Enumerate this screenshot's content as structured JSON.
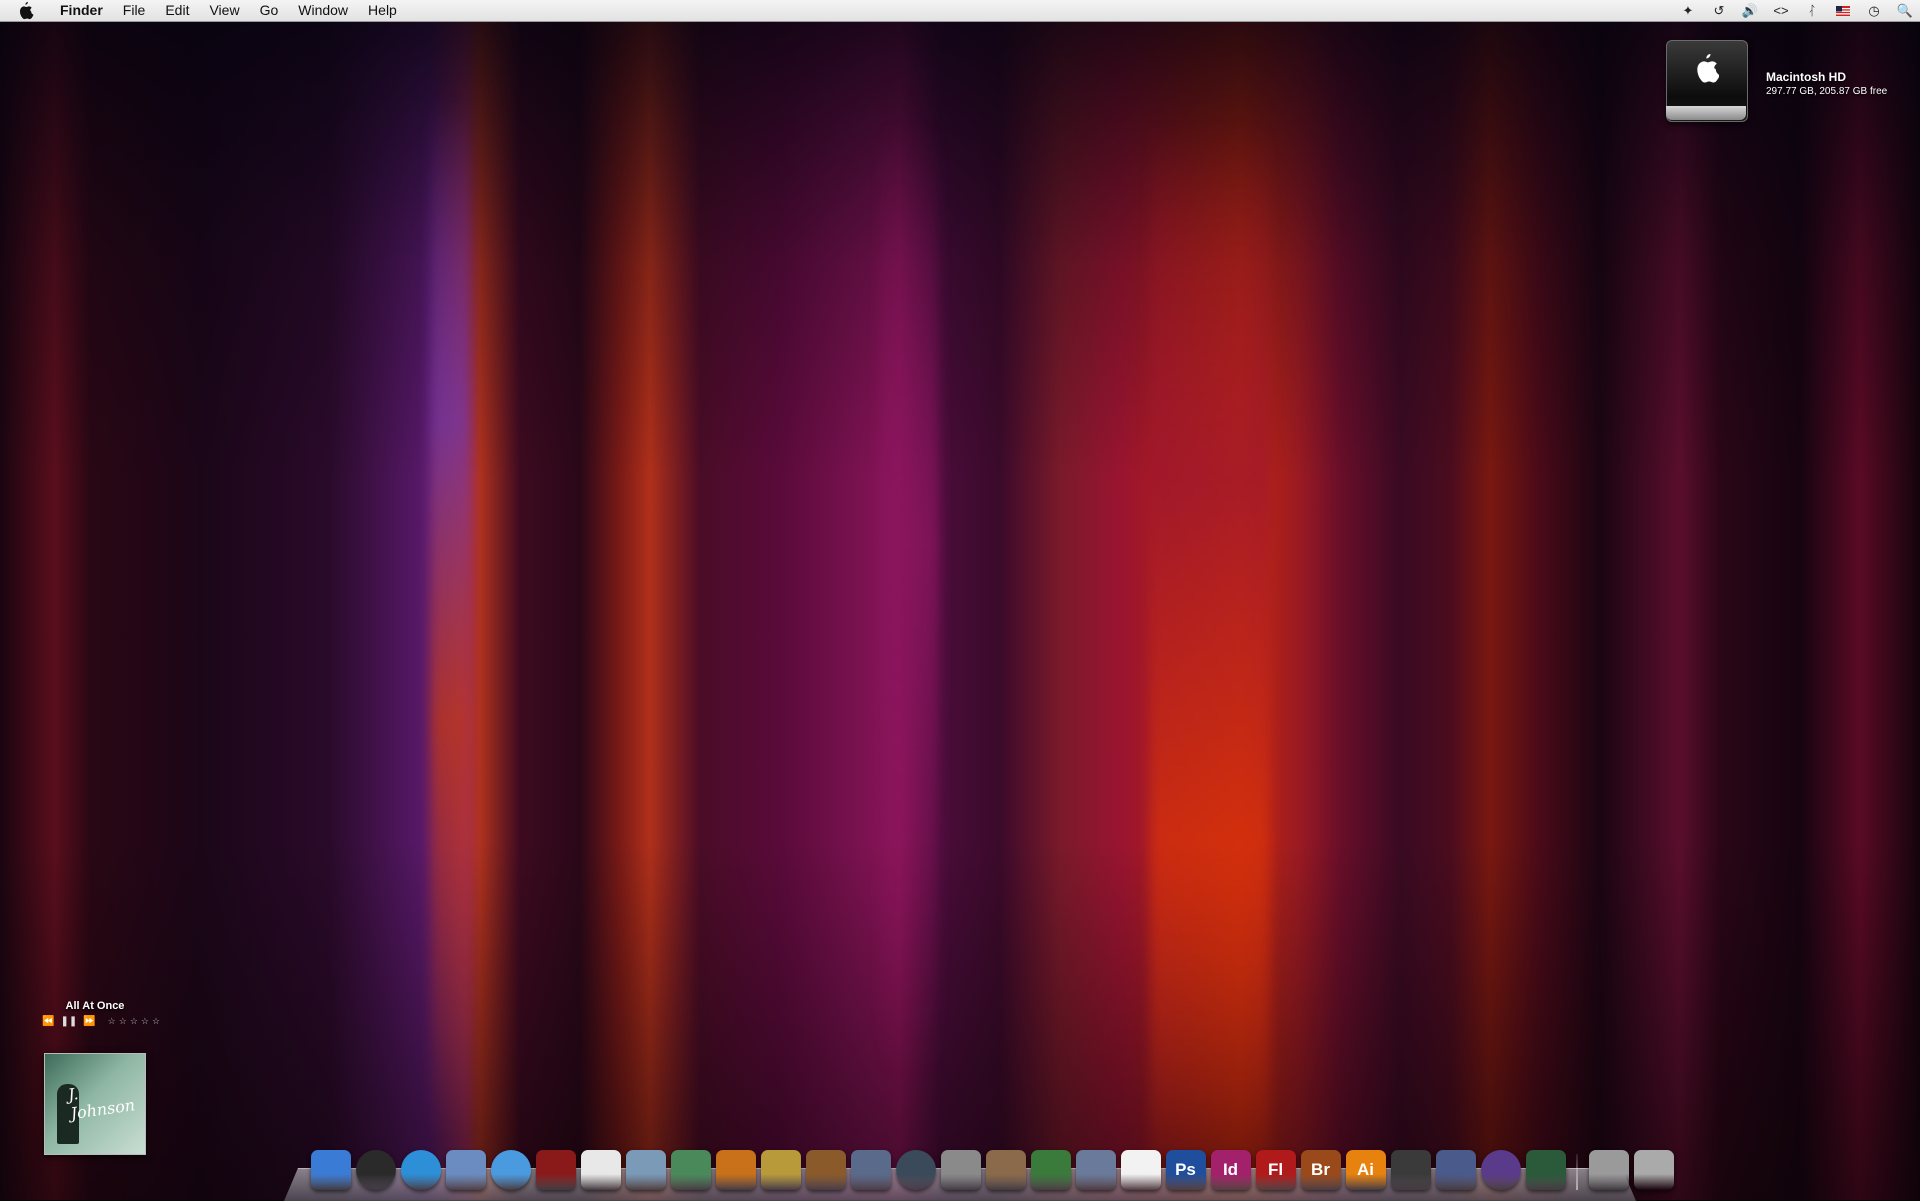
{
  "menubar": {
    "app_name": "Finder",
    "items": [
      "File",
      "Edit",
      "View",
      "Go",
      "Window",
      "Help"
    ],
    "status_icons": [
      "growl-icon",
      "time-machine-icon",
      "volume-icon",
      "script-icon",
      "bluetooth-icon",
      "flag-icon",
      "clock-icon",
      "spotlight-icon"
    ]
  },
  "drive": {
    "name": "Macintosh HD",
    "info": "297.77 GB, 205.87 GB free"
  },
  "itunes": {
    "track_title": "All At Once",
    "rating_stars": 5
  },
  "dock": {
    "apps": [
      {
        "name": "finder-icon",
        "color": "#3a7bd5"
      },
      {
        "name": "dashboard-icon",
        "color": "#2a2a2a"
      },
      {
        "name": "safari-icon",
        "color": "#2c8fd8"
      },
      {
        "name": "mail-icon",
        "color": "#6a8cc0"
      },
      {
        "name": "ichat-icon",
        "color": "#4a9ae0"
      },
      {
        "name": "dictionary-icon",
        "color": "#8a1a1a"
      },
      {
        "name": "ical-icon",
        "color": "#e8e8e8"
      },
      {
        "name": "preview-icon",
        "color": "#7a9ab8"
      },
      {
        "name": "iphoto-icon",
        "color": "#4a8a5a"
      },
      {
        "name": "image-capture-icon",
        "color": "#c8701a"
      },
      {
        "name": "imovie-icon",
        "color": "#b89a3a"
      },
      {
        "name": "garageband-icon",
        "color": "#8a5a2a"
      },
      {
        "name": "spaces-icon",
        "color": "#5a6a8a"
      },
      {
        "name": "time-machine-icon",
        "color": "#3a4a5a"
      },
      {
        "name": "system-preferences-icon",
        "color": "#8a8a8a"
      },
      {
        "name": "keynote-icon",
        "color": "#8a6a4a"
      },
      {
        "name": "numbers-icon",
        "color": "#3a7a3a"
      },
      {
        "name": "pages-icon",
        "color": "#6a7a9a"
      },
      {
        "name": "acrobat-icon",
        "color": "#f2f2f2"
      },
      {
        "name": "photoshop-icon",
        "color": "#1e4e9c",
        "label": "Ps"
      },
      {
        "name": "indesign-icon",
        "color": "#a3206a",
        "label": "Id"
      },
      {
        "name": "flash-icon",
        "color": "#b01a1a",
        "label": "Fl"
      },
      {
        "name": "bridge-icon",
        "color": "#9a4a1a",
        "label": "Br"
      },
      {
        "name": "illustrator-icon",
        "color": "#e8820e",
        "label": "Ai"
      },
      {
        "name": "final-cut-icon",
        "color": "#3a3a3a"
      },
      {
        "name": "livetype-icon",
        "color": "#4a5a8a"
      },
      {
        "name": "motion-icon",
        "color": "#5a3a8a"
      },
      {
        "name": "soundtrack-icon",
        "color": "#2a5a3a"
      }
    ],
    "trailing": [
      {
        "name": "downloads-stack-icon",
        "color": "#9a9a9a"
      },
      {
        "name": "trash-icon",
        "color": "#aaaaaa"
      }
    ]
  }
}
